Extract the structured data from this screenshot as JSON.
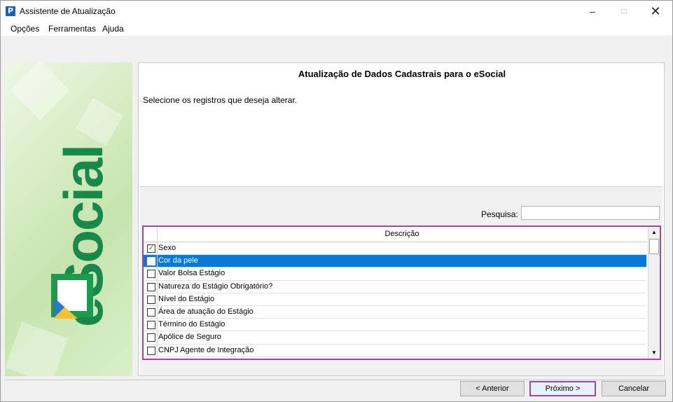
{
  "window": {
    "title": "Assistente de Atualização",
    "icon_letter": "P",
    "controls": {
      "minimize": "–",
      "maximize": "□",
      "close": "✕"
    }
  },
  "menu": {
    "items": [
      "Opções",
      "Ferramentas",
      "Ajuda"
    ]
  },
  "brand": {
    "word": "eSocial",
    "colors": {
      "green": "#18894a",
      "blue": "#2b78c8",
      "yellow": "#f1c232"
    }
  },
  "header": {
    "title": "Atualização de Dados Cadastrais para o eSocial"
  },
  "instructions": "Selecione os registros que deseja alterar.",
  "search": {
    "label": "Pesquisa:",
    "value": ""
  },
  "grid": {
    "column_header": "Descrição",
    "rows": [
      {
        "label": "Sexo",
        "checked": true,
        "selected": false
      },
      {
        "label": "Cor da pele",
        "checked": false,
        "selected": true
      },
      {
        "label": "Valor Bolsa Estágio",
        "checked": false,
        "selected": false
      },
      {
        "label": "Natureza do Estágio Obrigatório?",
        "checked": false,
        "selected": false
      },
      {
        "label": "Nível do Estágio",
        "checked": false,
        "selected": false
      },
      {
        "label": "Área de atuação do Estágio",
        "checked": false,
        "selected": false
      },
      {
        "label": "Término do Estágio",
        "checked": false,
        "selected": false
      },
      {
        "label": "Apólice de Seguro",
        "checked": false,
        "selected": false
      },
      {
        "label": "CNPJ Agente de Integração",
        "checked": false,
        "selected": false
      }
    ],
    "colors": {
      "highlight": "#9b4aa3",
      "selection": "#0a78d7"
    }
  },
  "footer": {
    "prev_label": "< Anterior",
    "next_label": "Próximo >",
    "cancel_label": "Cancelar"
  }
}
